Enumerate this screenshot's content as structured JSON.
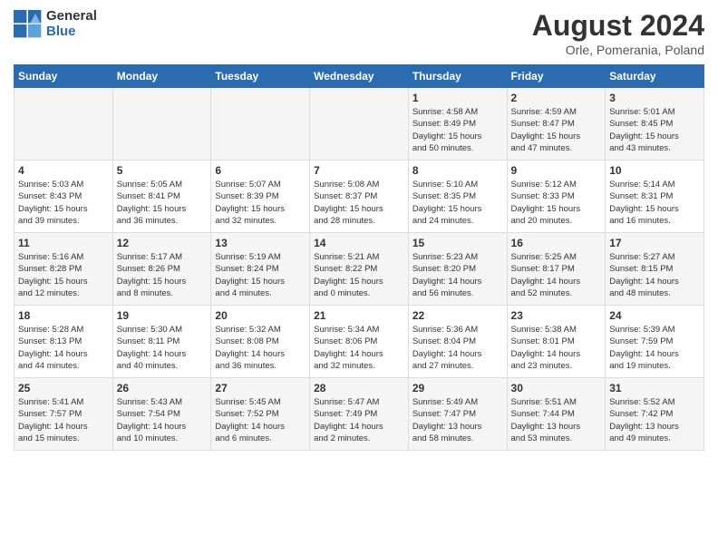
{
  "header": {
    "logo_general": "General",
    "logo_blue": "Blue",
    "title": "August 2024",
    "subtitle": "Orle, Pomerania, Poland"
  },
  "days_of_week": [
    "Sunday",
    "Monday",
    "Tuesday",
    "Wednesday",
    "Thursday",
    "Friday",
    "Saturday"
  ],
  "weeks": [
    [
      {
        "day": "",
        "info": ""
      },
      {
        "day": "",
        "info": ""
      },
      {
        "day": "",
        "info": ""
      },
      {
        "day": "",
        "info": ""
      },
      {
        "day": "1",
        "info": "Sunrise: 4:58 AM\nSunset: 8:49 PM\nDaylight: 15 hours\nand 50 minutes."
      },
      {
        "day": "2",
        "info": "Sunrise: 4:59 AM\nSunset: 8:47 PM\nDaylight: 15 hours\nand 47 minutes."
      },
      {
        "day": "3",
        "info": "Sunrise: 5:01 AM\nSunset: 8:45 PM\nDaylight: 15 hours\nand 43 minutes."
      }
    ],
    [
      {
        "day": "4",
        "info": "Sunrise: 5:03 AM\nSunset: 8:43 PM\nDaylight: 15 hours\nand 39 minutes."
      },
      {
        "day": "5",
        "info": "Sunrise: 5:05 AM\nSunset: 8:41 PM\nDaylight: 15 hours\nand 36 minutes."
      },
      {
        "day": "6",
        "info": "Sunrise: 5:07 AM\nSunset: 8:39 PM\nDaylight: 15 hours\nand 32 minutes."
      },
      {
        "day": "7",
        "info": "Sunrise: 5:08 AM\nSunset: 8:37 PM\nDaylight: 15 hours\nand 28 minutes."
      },
      {
        "day": "8",
        "info": "Sunrise: 5:10 AM\nSunset: 8:35 PM\nDaylight: 15 hours\nand 24 minutes."
      },
      {
        "day": "9",
        "info": "Sunrise: 5:12 AM\nSunset: 8:33 PM\nDaylight: 15 hours\nand 20 minutes."
      },
      {
        "day": "10",
        "info": "Sunrise: 5:14 AM\nSunset: 8:31 PM\nDaylight: 15 hours\nand 16 minutes."
      }
    ],
    [
      {
        "day": "11",
        "info": "Sunrise: 5:16 AM\nSunset: 8:28 PM\nDaylight: 15 hours\nand 12 minutes."
      },
      {
        "day": "12",
        "info": "Sunrise: 5:17 AM\nSunset: 8:26 PM\nDaylight: 15 hours\nand 8 minutes."
      },
      {
        "day": "13",
        "info": "Sunrise: 5:19 AM\nSunset: 8:24 PM\nDaylight: 15 hours\nand 4 minutes."
      },
      {
        "day": "14",
        "info": "Sunrise: 5:21 AM\nSunset: 8:22 PM\nDaylight: 15 hours\nand 0 minutes."
      },
      {
        "day": "15",
        "info": "Sunrise: 5:23 AM\nSunset: 8:20 PM\nDaylight: 14 hours\nand 56 minutes."
      },
      {
        "day": "16",
        "info": "Sunrise: 5:25 AM\nSunset: 8:17 PM\nDaylight: 14 hours\nand 52 minutes."
      },
      {
        "day": "17",
        "info": "Sunrise: 5:27 AM\nSunset: 8:15 PM\nDaylight: 14 hours\nand 48 minutes."
      }
    ],
    [
      {
        "day": "18",
        "info": "Sunrise: 5:28 AM\nSunset: 8:13 PM\nDaylight: 14 hours\nand 44 minutes."
      },
      {
        "day": "19",
        "info": "Sunrise: 5:30 AM\nSunset: 8:11 PM\nDaylight: 14 hours\nand 40 minutes."
      },
      {
        "day": "20",
        "info": "Sunrise: 5:32 AM\nSunset: 8:08 PM\nDaylight: 14 hours\nand 36 minutes."
      },
      {
        "day": "21",
        "info": "Sunrise: 5:34 AM\nSunset: 8:06 PM\nDaylight: 14 hours\nand 32 minutes."
      },
      {
        "day": "22",
        "info": "Sunrise: 5:36 AM\nSunset: 8:04 PM\nDaylight: 14 hours\nand 27 minutes."
      },
      {
        "day": "23",
        "info": "Sunrise: 5:38 AM\nSunset: 8:01 PM\nDaylight: 14 hours\nand 23 minutes."
      },
      {
        "day": "24",
        "info": "Sunrise: 5:39 AM\nSunset: 7:59 PM\nDaylight: 14 hours\nand 19 minutes."
      }
    ],
    [
      {
        "day": "25",
        "info": "Sunrise: 5:41 AM\nSunset: 7:57 PM\nDaylight: 14 hours\nand 15 minutes."
      },
      {
        "day": "26",
        "info": "Sunrise: 5:43 AM\nSunset: 7:54 PM\nDaylight: 14 hours\nand 10 minutes."
      },
      {
        "day": "27",
        "info": "Sunrise: 5:45 AM\nSunset: 7:52 PM\nDaylight: 14 hours\nand 6 minutes."
      },
      {
        "day": "28",
        "info": "Sunrise: 5:47 AM\nSunset: 7:49 PM\nDaylight: 14 hours\nand 2 minutes."
      },
      {
        "day": "29",
        "info": "Sunrise: 5:49 AM\nSunset: 7:47 PM\nDaylight: 13 hours\nand 58 minutes."
      },
      {
        "day": "30",
        "info": "Sunrise: 5:51 AM\nSunset: 7:44 PM\nDaylight: 13 hours\nand 53 minutes."
      },
      {
        "day": "31",
        "info": "Sunrise: 5:52 AM\nSunset: 7:42 PM\nDaylight: 13 hours\nand 49 minutes."
      }
    ]
  ]
}
